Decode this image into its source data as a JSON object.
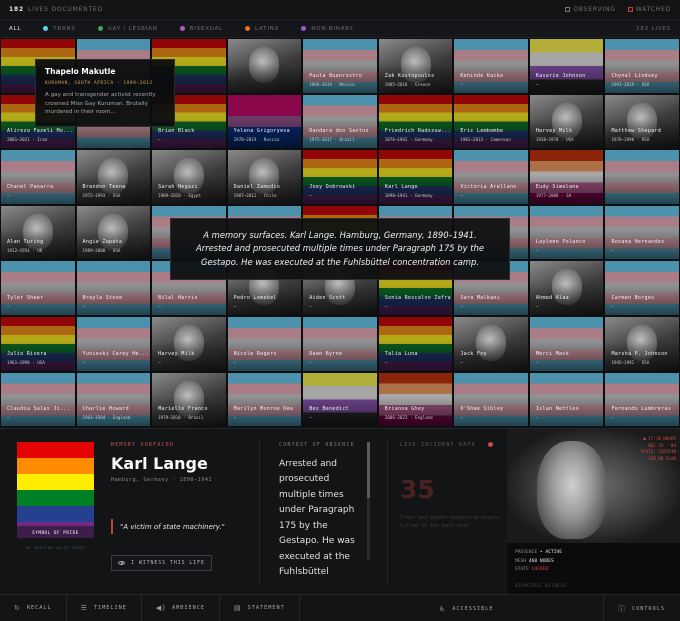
{
  "topbar": {
    "count": "182",
    "count_label": "LIVES DOCUMENTED",
    "right_items": [
      "OBSERVING",
      "WATCHED"
    ]
  },
  "filters": {
    "items": [
      {
        "label": "ALL",
        "color": ""
      },
      {
        "label": "TRANS",
        "color": "#5bcefa"
      },
      {
        "label": "GAY / LESBIAN",
        "color": "#3aa75a"
      },
      {
        "label": "BISEXUAL",
        "color": "#b05ac8"
      },
      {
        "label": "LATINX",
        "color": "#e07030"
      },
      {
        "label": "NON-BINARY",
        "color": "#9c59d1"
      }
    ],
    "total": "182 LIVES"
  },
  "grid": {
    "cells": [
      {
        "flag": "rainbow",
        "name": "",
        "years": ""
      },
      {
        "flag": "trans",
        "name": "",
        "years": ""
      },
      {
        "flag": "rainbow",
        "name": "",
        "years": ""
      },
      {
        "flag": "photo",
        "name": "",
        "years": ""
      },
      {
        "flag": "trans",
        "name": "Paula Buenrostro",
        "years": "1969–2019 · Mexico"
      },
      {
        "flag": "photo",
        "name": "Zak Kostopoulos",
        "years": "1985–2018 · Greece"
      },
      {
        "flag": "trans",
        "name": "Kehinde Kaiko",
        "years": "—"
      },
      {
        "flag": "nb",
        "name": "Kasarie Johnson",
        "years": "—"
      },
      {
        "flag": "trans",
        "name": "Chynal Lindsey",
        "years": "1993–2019 · USA"
      },
      {
        "flag": "rainbow",
        "name": "Alireza Fazeli Mo...",
        "years": "2001–2021 · Iran"
      },
      {
        "flag": "trans",
        "name": "",
        "years": ""
      },
      {
        "flag": "rainbow",
        "name": "Brian Black",
        "years": "—"
      },
      {
        "flag": "bi",
        "name": "Yelena Grigoryeva",
        "years": "1978–2019 · Russia"
      },
      {
        "flag": "trans",
        "name": "Dandara dos Santos",
        "years": "1975–2017 · Brazil"
      },
      {
        "flag": "rainbow",
        "name": "Friedrich Radszuw...",
        "years": "1876–1942 · Germany"
      },
      {
        "flag": "rainbow",
        "name": "Eric Lembembe",
        "years": "1981–2013 · Cameroon"
      },
      {
        "flag": "photo",
        "name": "Harvey Milk",
        "years": "1930–1978 · USA"
      },
      {
        "flag": "photo",
        "name": "Matthew Shepard",
        "years": "1976–1998 · USA"
      },
      {
        "flag": "trans",
        "name": "Chanel Panarra",
        "years": "—"
      },
      {
        "flag": "photo",
        "name": "Brandon Teena",
        "years": "1972–1993 · USA"
      },
      {
        "flag": "photo",
        "name": "Sarah Hegazi",
        "years": "1989–2020 · Egypt"
      },
      {
        "flag": "photo",
        "name": "Daniel Zamudio",
        "years": "1987–2012 · Chile"
      },
      {
        "flag": "rainbow",
        "name": "Joey Dobrowski",
        "years": "—"
      },
      {
        "flag": "rainbow",
        "name": "Karl Lange",
        "years": "1890–1941 · Germany"
      },
      {
        "flag": "trans",
        "name": "Victoria Arellano",
        "years": "—"
      },
      {
        "flag": "lesbian",
        "name": "Eudy Simelane",
        "years": "1977–2008 · SA"
      },
      {
        "flag": "trans",
        "name": "",
        "years": ""
      },
      {
        "flag": "photo",
        "name": "Alan Turing",
        "years": "1912–1954 · UK"
      },
      {
        "flag": "photo",
        "name": "Angie Zapata",
        "years": "1989–2008 · USA"
      },
      {
        "flag": "trans",
        "name": "",
        "years": ""
      },
      {
        "flag": "trans",
        "name": "",
        "years": ""
      },
      {
        "flag": "rainbow",
        "name": "",
        "years": ""
      },
      {
        "flag": "trans",
        "name": "",
        "years": ""
      },
      {
        "flag": "trans",
        "name": "",
        "years": ""
      },
      {
        "flag": "trans",
        "name": "Layleen Polanco",
        "years": "—"
      },
      {
        "flag": "trans",
        "name": "Roxana Hernandez",
        "years": "—"
      },
      {
        "flag": "trans",
        "name": "Tyler Sheer",
        "years": "—"
      },
      {
        "flag": "trans",
        "name": "Brayla Stone",
        "years": "—"
      },
      {
        "flag": "trans",
        "name": "Bilal Harris",
        "years": "—"
      },
      {
        "flag": "photo",
        "name": "Pedro Lemebel",
        "years": "—"
      },
      {
        "flag": "photo",
        "name": "Aiden Scott",
        "years": "—"
      },
      {
        "flag": "rainbow",
        "name": "Sonia Rescalvo Zafra",
        "years": "—"
      },
      {
        "flag": "trans",
        "name": "Sara Malkani",
        "years": "—"
      },
      {
        "flag": "photo",
        "name": "Ahmed Alaa",
        "years": "—"
      },
      {
        "flag": "trans",
        "name": "Carmen Borges",
        "years": "—"
      },
      {
        "flag": "rainbow",
        "name": "Julio Rivera",
        "years": "1961–1990 · USA"
      },
      {
        "flag": "trans",
        "name": "Yunieski Carey He...",
        "years": "—"
      },
      {
        "flag": "photo",
        "name": "Harvey Milk",
        "years": "—"
      },
      {
        "flag": "trans",
        "name": "Nicole Rogers",
        "years": "—"
      },
      {
        "flag": "trans",
        "name": "Dawn Byrne",
        "years": "—"
      },
      {
        "flag": "rainbow",
        "name": "Talia Luna",
        "years": "—"
      },
      {
        "flag": "photo",
        "name": "Jack Foy",
        "years": "—"
      },
      {
        "flag": "trans",
        "name": "Merci Mack",
        "years": "—"
      },
      {
        "flag": "photo",
        "name": "Marsha P. Johnson",
        "years": "1945–1992 · USA"
      },
      {
        "flag": "trans",
        "name": "Claudia Salas Ji...",
        "years": "—"
      },
      {
        "flag": "trans",
        "name": "Charlie Howard",
        "years": "1961–1984 · England"
      },
      {
        "flag": "photo",
        "name": "Marielle Franco",
        "years": "1979–2018 · Brazil"
      },
      {
        "flag": "trans",
        "name": "Marilyn Monroe Dea",
        "years": "—"
      },
      {
        "flag": "nb",
        "name": "Bex Benedict",
        "years": "—"
      },
      {
        "flag": "lesbian",
        "name": "Brianna Ghey",
        "years": "2006–2023 · England"
      },
      {
        "flag": "trans",
        "name": "O'Shae Sibley",
        "years": "—"
      },
      {
        "flag": "trans",
        "name": "Islan Nettles",
        "years": "—"
      },
      {
        "flag": "trans",
        "name": "Fernando Lumbreras",
        "years": "—"
      }
    ]
  },
  "tooltip": {
    "name": "Thapelo Makutle",
    "meta": "KURUMAN, SOUTH AFRICA · 1989–2012",
    "desc": "A gay and transgender activist recently crowned Miss Gay Kuruman. Brutally murdered in their room..."
  },
  "overlay": {
    "text": "A memory surfaces. Karl Lange. Hamburg, Germany, 1890–1941. Arrested and prosecuted multiple times under Paragraph 175 by the Gestapo. He was executed at the Fuhlsbüttel concentration camp."
  },
  "panel": {
    "flag_caption": "SYMBOL OF PRIDE",
    "flag_credit": "BY GRIFFIN GOLTS SPATS",
    "memory_label": "MEMORY SURFACED",
    "name": "Karl Lange",
    "meta": "Hamburg, Germany · 1890–1941",
    "quote": "\"A victim of state machinery.\"",
    "witness_button": "I WITNESS THIS LIFE",
    "context_label": "CONTEXT OF ABSENCE",
    "context_text": "Arrested and prosecuted multiple times under Paragraph 175 by the Gestapo. He was executed at the Fuhlsbüttel concentration camp.",
    "live_label": "LIVE INCIDENT DATA",
    "live_count": "35",
    "live_desc": "Trans and gender-expansive people killed in the past year",
    "cam_hud": [
      "● 17:18 HOURS",
      "REC 33 · 04",
      "STATE: CERTAIN",
      "348 KB SCAN"
    ],
    "cam_presence_label": "PRESENCE",
    "cam_presence_value": "• ACTIVE",
    "cam_mesh_label": "MESH",
    "cam_mesh_value": "468 NODES",
    "cam_state_label": "STATE",
    "cam_state_value": "LOCKED",
    "cam_footer": "BIOMETRIC WITNESS"
  },
  "nav": {
    "recall": "RECALL",
    "timeline": "TIMELINE",
    "ambience": "AMBIENCE",
    "statement": "STATEMENT",
    "accessible": "ACCESSIBLE",
    "controls": "CONTROLS"
  }
}
